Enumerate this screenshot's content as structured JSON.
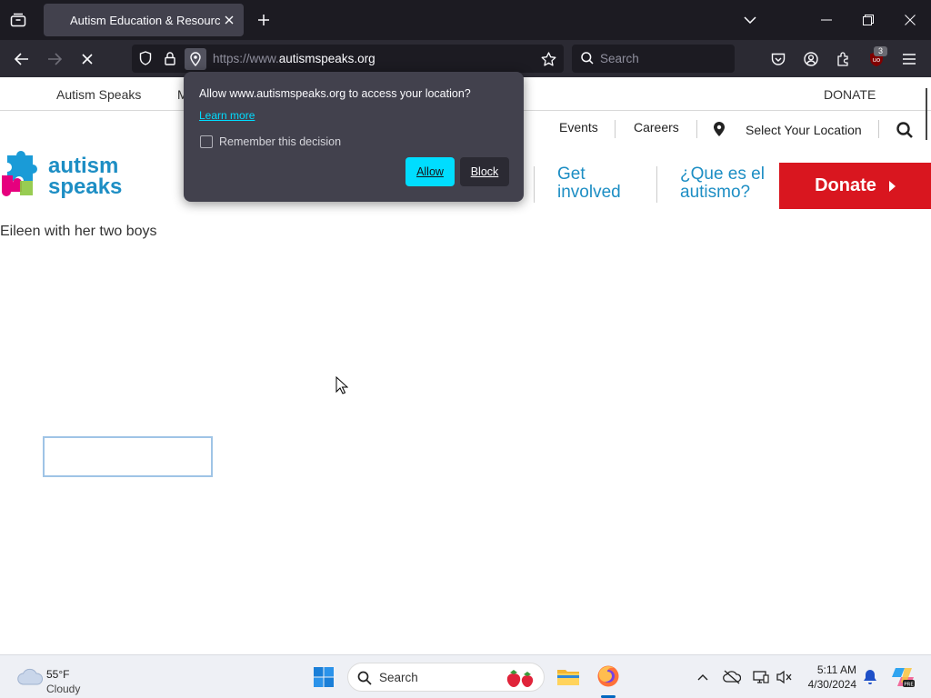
{
  "browser": {
    "tab_title": "Autism Education & Resources",
    "url_prefix": "https://www.",
    "url_domain": "autismspeaks.org",
    "search_placeholder": "Search",
    "extension_badge": "3"
  },
  "site": {
    "topnav": {
      "brand": "Autism Speaks",
      "partial": "M",
      "donate": "DONATE"
    },
    "subnav": {
      "events": "Events",
      "careers": "Careers",
      "location": "Select Your Location"
    },
    "logo": {
      "line1": "autism",
      "line2": "speaks"
    },
    "mainnav": {
      "get_involved_1": "Get",
      "get_involved_2": "involved",
      "que_1": "¿Que es el",
      "que_2": "autismo?"
    },
    "donate_button": "Donate",
    "caption": "Eileen with her two boys"
  },
  "popup": {
    "title": "Allow www.autismspeaks.org to access your location?",
    "learn_more": "Learn more",
    "remember": "Remember this decision",
    "allow": "Allow",
    "block": "Block"
  },
  "taskbar": {
    "weather_temp": "55°F",
    "weather_desc": "Cloudy",
    "search": "Search",
    "time": "5:11 AM",
    "date": "4/30/2024"
  }
}
